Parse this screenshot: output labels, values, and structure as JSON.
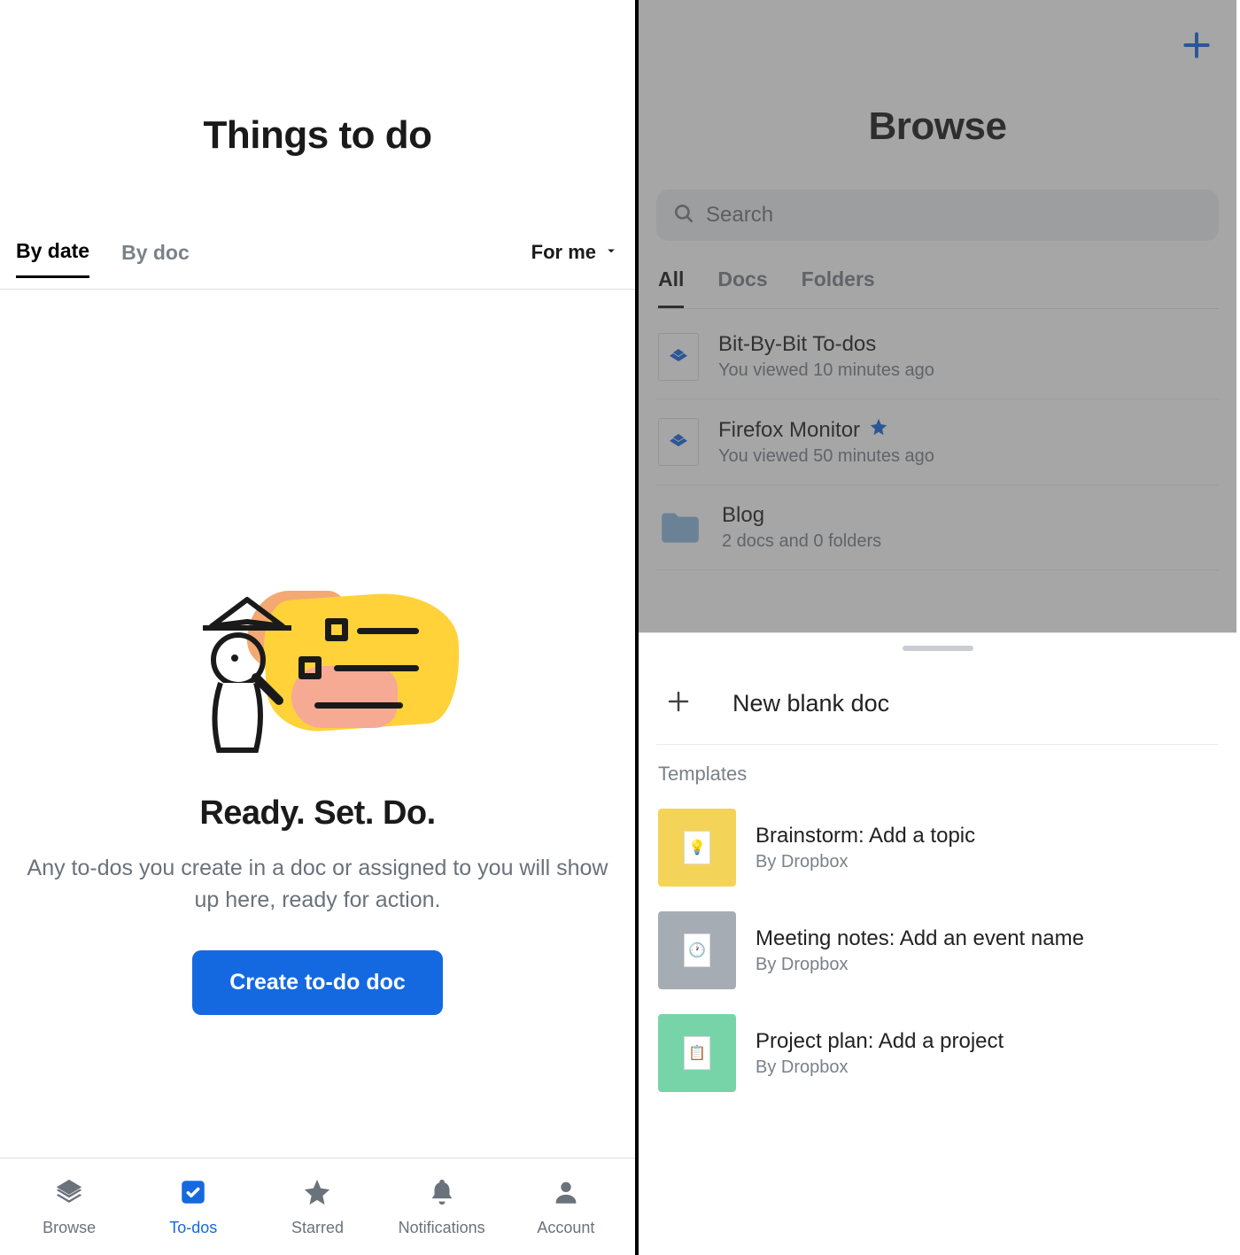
{
  "left": {
    "title": "Things to do",
    "tabs": {
      "by_date": "By date",
      "by_doc": "By doc"
    },
    "filter": "For me",
    "empty": {
      "heading": "Ready. Set. Do.",
      "sub": "Any to-dos you create in a doc or assigned to you will show up here, ready for action.",
      "cta": "Create to-do doc"
    },
    "nav": {
      "browse": "Browse",
      "todos": "To-dos",
      "starred": "Starred",
      "notifications": "Notifications",
      "account": "Account"
    }
  },
  "right": {
    "title": "Browse",
    "search_placeholder": "Search",
    "tabs": {
      "all": "All",
      "docs": "Docs",
      "folders": "Folders"
    },
    "docs": [
      {
        "name": "Bit-By-Bit To-dos",
        "meta": "You viewed 10 minutes ago",
        "starred": false,
        "type": "doc"
      },
      {
        "name": "Firefox Monitor",
        "meta": "You viewed 50 minutes ago",
        "starred": true,
        "type": "doc"
      },
      {
        "name": "Blog",
        "meta": "2 docs and 0 folders",
        "starred": false,
        "type": "folder"
      }
    ],
    "sheet": {
      "new_doc": "New blank doc",
      "templates_heading": "Templates",
      "templates": [
        {
          "name": "Brainstorm: Add a topic",
          "by": "By Dropbox",
          "color": "#f4d458",
          "emoji": "💡"
        },
        {
          "name": "Meeting notes: Add an event name",
          "by": "By Dropbox",
          "color": "#a5acb4",
          "emoji": "🕐"
        },
        {
          "name": "Project plan: Add a project",
          "by": "By Dropbox",
          "color": "#77d4a8",
          "emoji": "📋"
        }
      ]
    }
  },
  "colors": {
    "accent": "#1569e0"
  }
}
